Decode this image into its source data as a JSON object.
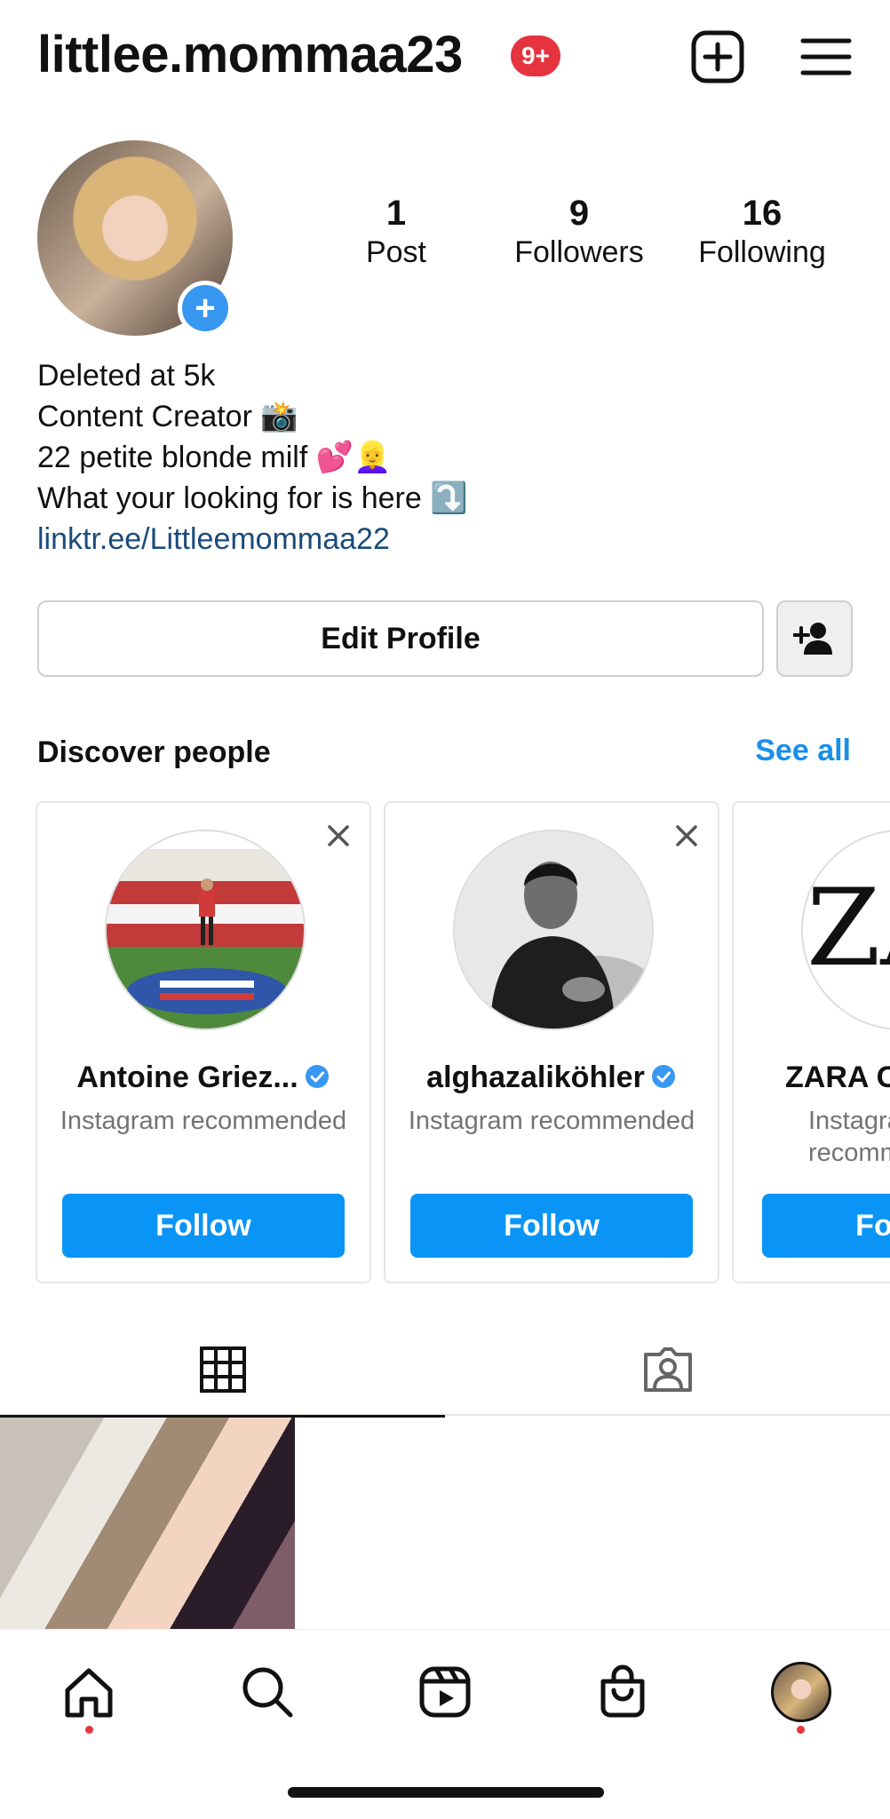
{
  "header": {
    "username": "littlee.mommaa23",
    "notification_badge": "9+",
    "icons": [
      "new-post-icon",
      "menu-icon"
    ]
  },
  "profile": {
    "stats": [
      {
        "value": "1",
        "label": "Post"
      },
      {
        "value": "9",
        "label": "Followers"
      },
      {
        "value": "16",
        "label": "Following"
      }
    ],
    "avatar_add_glyph": "+",
    "bio": [
      "Deleted at 5k",
      "Content Creator 📸",
      "22 petite blonde milf 💕👱‍♀️",
      "What your looking for is here ⤵️"
    ],
    "link": "linktr.ee/Littleemommaa22"
  },
  "actions": {
    "edit_profile": "Edit Profile"
  },
  "discover": {
    "title": "Discover people",
    "see_all": "See all",
    "cards": [
      {
        "name": "Antoine Griez...",
        "verified": true,
        "subtitle": "Instagram recommended",
        "follow": "Follow"
      },
      {
        "name": "alghazaliköhler",
        "verified": true,
        "subtitle": "Instagram recommended",
        "follow": "Follow"
      },
      {
        "name": "ZARA O",
        "verified": false,
        "subtitle": "Instagram recommended",
        "follow": "Follow"
      }
    ]
  },
  "tabs": [
    {
      "icon": "grid-icon",
      "active": true
    },
    {
      "icon": "tagged-icon",
      "active": false
    }
  ],
  "bottom_nav": [
    "home-icon",
    "search-icon",
    "reels-icon",
    "shop-icon",
    "profile-avatar"
  ],
  "colors": {
    "accent": "#0a95f6",
    "link": "#1a4b7a",
    "badge": "#e5343f"
  }
}
